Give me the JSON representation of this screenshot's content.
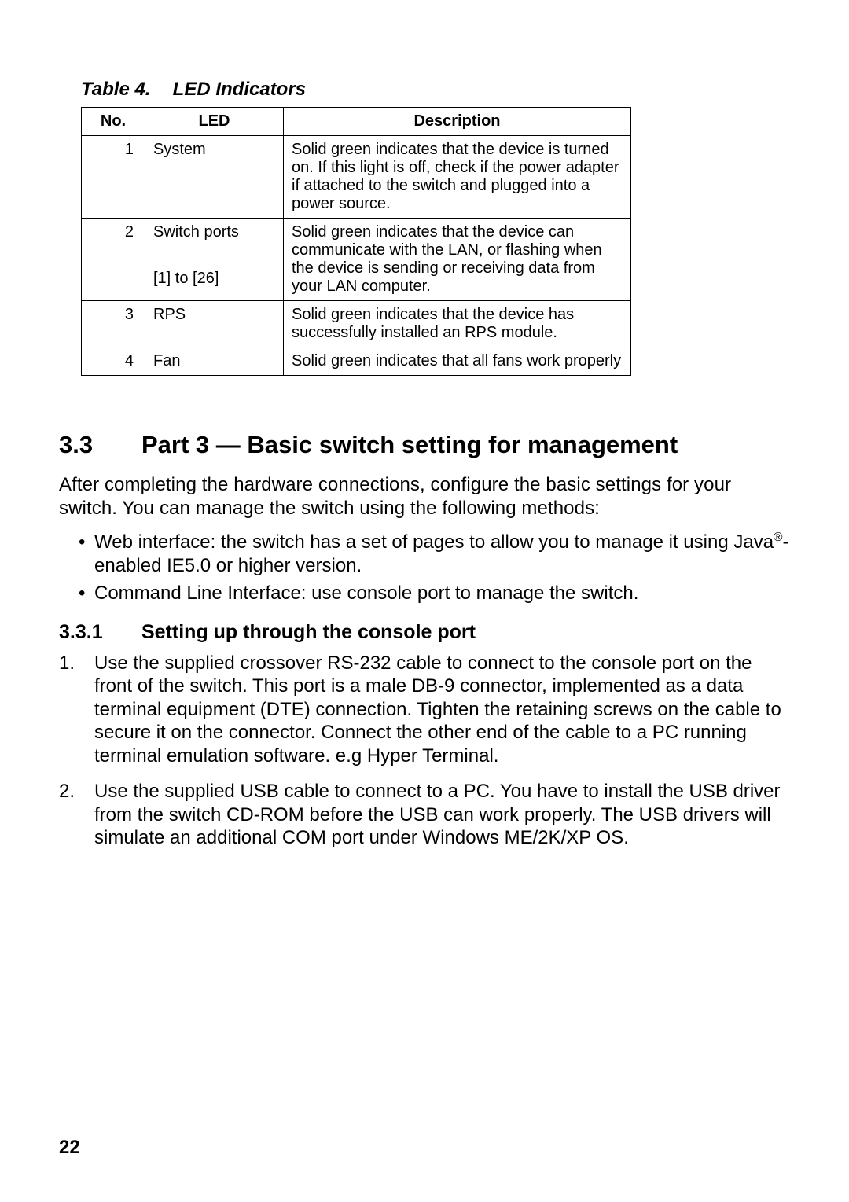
{
  "table": {
    "caption_label": "Table 4.",
    "caption_title": "LED Indicators",
    "headers": {
      "no": "No.",
      "led": "LED",
      "desc": "Description"
    },
    "rows": [
      {
        "no": "1",
        "led_main": "System",
        "led_sub": "",
        "desc": "Solid green indicates that the device is turned on. If this light is off, check if the power adapter if attached to the switch and plugged into a power source."
      },
      {
        "no": "2",
        "led_main": "Switch ports",
        "led_sub": "[1] to [26]",
        "desc": "Solid green indicates that the device can communicate with the LAN, or flashing when the device is sending or receiving data from your LAN computer."
      },
      {
        "no": "3",
        "led_main": "RPS",
        "led_sub": "",
        "desc": "Solid green indicates that the device has successfully installed an RPS module."
      },
      {
        "no": "4",
        "led_main": "Fan",
        "led_sub": "",
        "desc": "Solid green indicates that all fans work properly"
      }
    ]
  },
  "section": {
    "h2_num": "3.3",
    "h2_title": "Part 3 — Basic switch setting for management",
    "intro": "After completing the hardware connections, configure the basic settings for your switch. You can manage the switch using the following methods:",
    "bullets": [
      {
        "pre": "Web interface: the switch has a set of pages to allow you to manage it using Java",
        "sup": "®",
        "post": "-enabled IE5.0 or higher version."
      },
      {
        "pre": "Command Line Interface: use console port to manage the switch.",
        "sup": "",
        "post": ""
      }
    ],
    "h3_num": "3.3.1",
    "h3_title": "Setting up through the console port",
    "steps": [
      "Use the supplied crossover RS-232 cable to connect to the console port on the front of the switch. This port is a male DB-9 connector, implemented as a data terminal equipment (DTE) connection. Tighten the retaining screws on the cable to secure it on the connector. Connect the other end of the cable to a PC running terminal emulation software. e.g Hyper Terminal.",
      "Use the supplied USB cable to connect to a PC. You have to install the USB driver from the switch CD-ROM before the USB can work properly. The USB drivers will simulate an additional COM port under Windows ME/2K/XP OS."
    ]
  },
  "page_number": "22"
}
